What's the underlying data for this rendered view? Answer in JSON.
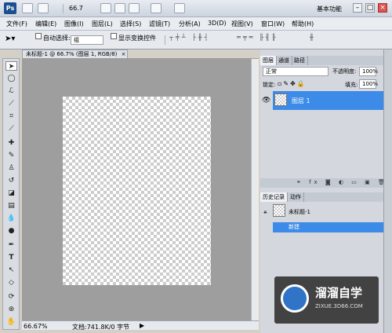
{
  "app": {
    "logo": "Ps",
    "zoom": "66.7",
    "workspace": "基本功能"
  },
  "window_controls": {
    "minimize": "–",
    "restore": "□",
    "close": "×"
  },
  "menu": [
    "文件(F)",
    "编辑(E)",
    "图像(I)",
    "图层(L)",
    "选择(S)",
    "滤镜(T)",
    "分析(A)",
    "3D(D)",
    "视图(V)",
    "窗口(W)",
    "帮助(H)"
  ],
  "options": {
    "auto_select_label": "自动选择:",
    "auto_select_value": "组",
    "show_transform": "显示变换控件"
  },
  "document": {
    "tab_title": "未标题-1 @ 66.7% (图层 1, RGB/8)",
    "tab_close": "×",
    "zoom_status": "66.67%",
    "doc_info": "文档:741.8K/0 字节"
  },
  "layers_panel": {
    "tabs": [
      "图层",
      "通道",
      "路径"
    ],
    "blend_mode": "正常",
    "opacity_label": "不透明度:",
    "opacity_value": "100%",
    "lock_label": "锁定:",
    "fill_label": "填充:",
    "fill_value": "100%",
    "layers": [
      {
        "name": "图层 1",
        "selected": true,
        "visible": true
      }
    ]
  },
  "history_panel": {
    "tabs": [
      "历史记录",
      "动作"
    ],
    "snapshot": "未标题-1",
    "items": [
      {
        "name": "新建",
        "selected": true
      }
    ]
  },
  "watermark": {
    "title": "溜溜自学",
    "subtitle": "ZIXUE.3D66.COM"
  },
  "colors": {
    "selection": "#3d8be8",
    "canvas_bg": "#9e9e9e"
  }
}
